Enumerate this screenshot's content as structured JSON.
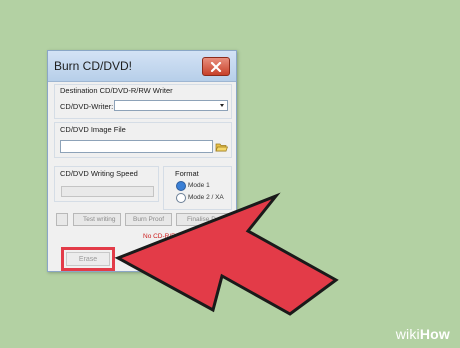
{
  "dialog": {
    "title": "Burn CD/DVD!",
    "close_icon": "close-icon"
  },
  "destination": {
    "group_label": "Destination CD/DVD-R/RW Writer",
    "writer_label": "CD/DVD-Writer:",
    "writer_value": ""
  },
  "image_file": {
    "group_label": "CD/DVD Image File",
    "value": "",
    "folder_icon": "folder-icon"
  },
  "writing_speed": {
    "group_label": "CD/DVD Writing Speed",
    "value": ""
  },
  "format": {
    "group_label": "Format",
    "options": [
      "Mode 1",
      "Mode 2 / XA"
    ],
    "selected": "Mode 1"
  },
  "options": {
    "test_writing": "Test writing",
    "burn_proof": "Burn Proof",
    "finalize": "Finalise D"
  },
  "status": {
    "text": "No CD-R/RW d"
  },
  "actions": {
    "erase_label": "Erase"
  },
  "annotation": {
    "arrow_color": "#e33b48",
    "highlight_color": "#e33b48"
  },
  "watermark": {
    "prefix": "wiki",
    "suffix": "How"
  }
}
